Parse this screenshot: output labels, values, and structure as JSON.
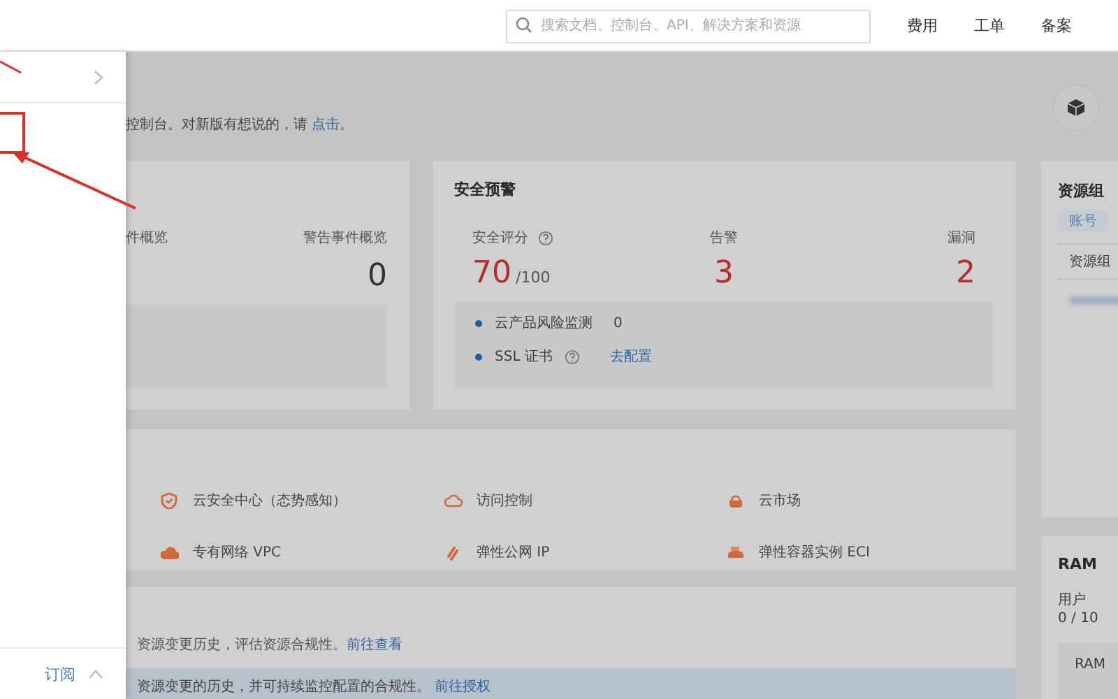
{
  "top_bar": {
    "search": {
      "placeholder": "搜索文档、控制台、API、解决方案和资源"
    },
    "nav": [
      "费用",
      "工单",
      "备案"
    ]
  },
  "drawer": {
    "footer_label": "订阅"
  },
  "notice": {
    "text": "控制台。对新版有想说的，请 ",
    "link": "点击",
    "end": "。"
  },
  "event_overview": {
    "items": [
      {
        "label": "件概览"
      },
      {
        "label": "警告事件概览",
        "value": "0"
      }
    ]
  },
  "security_alert": {
    "title": "安全预警",
    "metrics": [
      {
        "label": "安全评分",
        "help": true,
        "value": "70",
        "suffix": "/100"
      },
      {
        "label": "告警",
        "help": false,
        "value": "3"
      },
      {
        "label": "漏洞",
        "help": false,
        "value": "2"
      }
    ],
    "checks": [
      {
        "label": "云产品风险监测",
        "help": false,
        "value": "0"
      },
      {
        "label": "SSL 证书",
        "help": true,
        "link": "去配置"
      }
    ]
  },
  "quick_links": [
    {
      "label": "云安全中心（态势感知）",
      "kind": "shield"
    },
    {
      "label": "访问控制",
      "kind": "cloud-outline"
    },
    {
      "label": "云市场",
      "kind": "market"
    },
    {
      "label": "专有网络 VPC",
      "kind": "cloud"
    },
    {
      "label": "弹性公网 IP",
      "kind": "link"
    },
    {
      "label": "弹性容器实例 ECI",
      "kind": "container"
    }
  ],
  "resource_audit": {
    "text": "资源变更历史，评估资源合规性。",
    "link": "前往查看",
    "banner": {
      "text": "资源变更的历史，并可持续监控配置的合规性。",
      "link": "前往授权"
    }
  },
  "resource_group": {
    "title": "资源组",
    "tag": "账号",
    "row": "资源组"
  },
  "ram": {
    "title": "RAM",
    "stat_label": "用户",
    "stat_value": "0 / 10",
    "inner_title": "RAM"
  }
}
